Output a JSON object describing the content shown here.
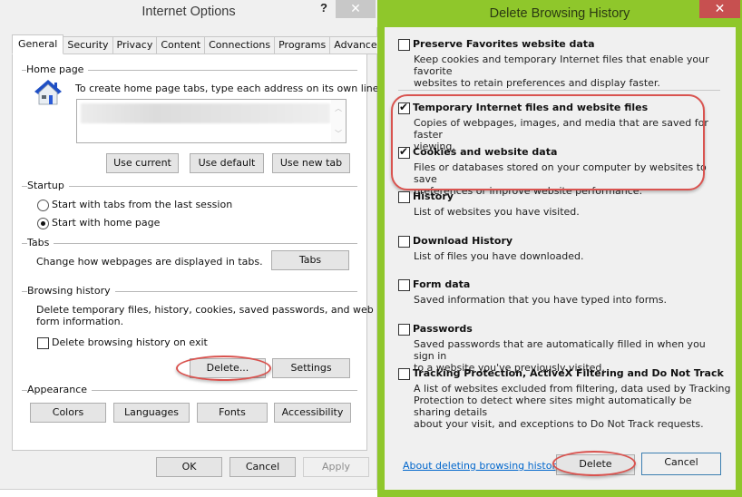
{
  "internet_options": {
    "title": "Internet Options",
    "help_label": "?",
    "close_label": "✕",
    "tabs": [
      {
        "label": "General",
        "active": true
      },
      {
        "label": "Security",
        "active": false
      },
      {
        "label": "Privacy",
        "active": false
      },
      {
        "label": "Content",
        "active": false
      },
      {
        "label": "Connections",
        "active": false
      },
      {
        "label": "Programs",
        "active": false
      },
      {
        "label": "Advanced",
        "active": false
      }
    ],
    "home_page": {
      "group_label": "Home page",
      "icon": "house-icon",
      "instruction": "To create home page tabs, type each address on its own line.",
      "url_value": "",
      "buttons": {
        "use_current": "Use current",
        "use_default": "Use default",
        "use_new_tab": "Use new tab"
      }
    },
    "startup": {
      "group_label": "Startup",
      "options": [
        {
          "label": "Start with tabs from the last session",
          "selected": false
        },
        {
          "label": "Start with home page",
          "selected": true
        }
      ]
    },
    "tabs_group": {
      "group_label": "Tabs",
      "description": "Change how webpages are displayed in tabs.",
      "button": "Tabs"
    },
    "browsing_history": {
      "group_label": "Browsing history",
      "description_line1": "Delete temporary files, history, cookies, saved passwords, and web",
      "description_line2": "form information.",
      "delete_on_exit_label": "Delete browsing history on exit",
      "delete_on_exit_checked": false,
      "delete_button": "Delete...",
      "settings_button": "Settings"
    },
    "appearance": {
      "group_label": "Appearance",
      "buttons": {
        "colors": "Colors",
        "languages": "Languages",
        "fonts": "Fonts",
        "accessibility": "Accessibility"
      }
    },
    "footer": {
      "ok": "OK",
      "cancel": "Cancel",
      "apply": "Apply"
    }
  },
  "delete_browsing_history": {
    "title": "Delete Browsing History",
    "close_label": "✕",
    "options": [
      {
        "title": "Preserve Favorites website data",
        "checked": false,
        "desc_lines": [
          "Keep cookies and temporary Internet files that enable your favorite",
          "websites to retain preferences and display faster."
        ]
      },
      {
        "title": "Temporary Internet files and website files",
        "checked": true,
        "desc_lines": [
          "Copies of webpages, images, and media that are saved for faster",
          "viewing."
        ]
      },
      {
        "title": "Cookies and website data",
        "checked": true,
        "desc_lines": [
          "Files or databases stored on your computer by websites to save",
          "preferences or improve website performance."
        ]
      },
      {
        "title": "History",
        "checked": false,
        "desc_lines": [
          "List of websites you have visited."
        ]
      },
      {
        "title": "Download History",
        "checked": false,
        "desc_lines": [
          "List of files you have downloaded."
        ]
      },
      {
        "title": "Form data",
        "checked": false,
        "desc_lines": [
          "Saved information that you have typed into forms."
        ]
      },
      {
        "title": "Passwords",
        "checked": false,
        "desc_lines": [
          "Saved passwords that are automatically filled in when you sign in",
          "to a website you've previously visited."
        ]
      },
      {
        "title": "Tracking Protection, ActiveX Filtering and Do Not Track",
        "checked": false,
        "desc_lines": [
          "A list of websites excluded from filtering, data used by Tracking",
          "Protection to detect where sites might automatically be sharing details",
          "about your visit, and exceptions to Do Not Track requests."
        ]
      }
    ],
    "about_link": "About deleting browsing history",
    "delete_button": "Delete",
    "cancel_button": "Cancel"
  },
  "colors": {
    "dialog_frame": "#8fc72b",
    "close_red": "#c75050",
    "annotation_red": "#d9534f",
    "link_blue": "#0066cc"
  }
}
